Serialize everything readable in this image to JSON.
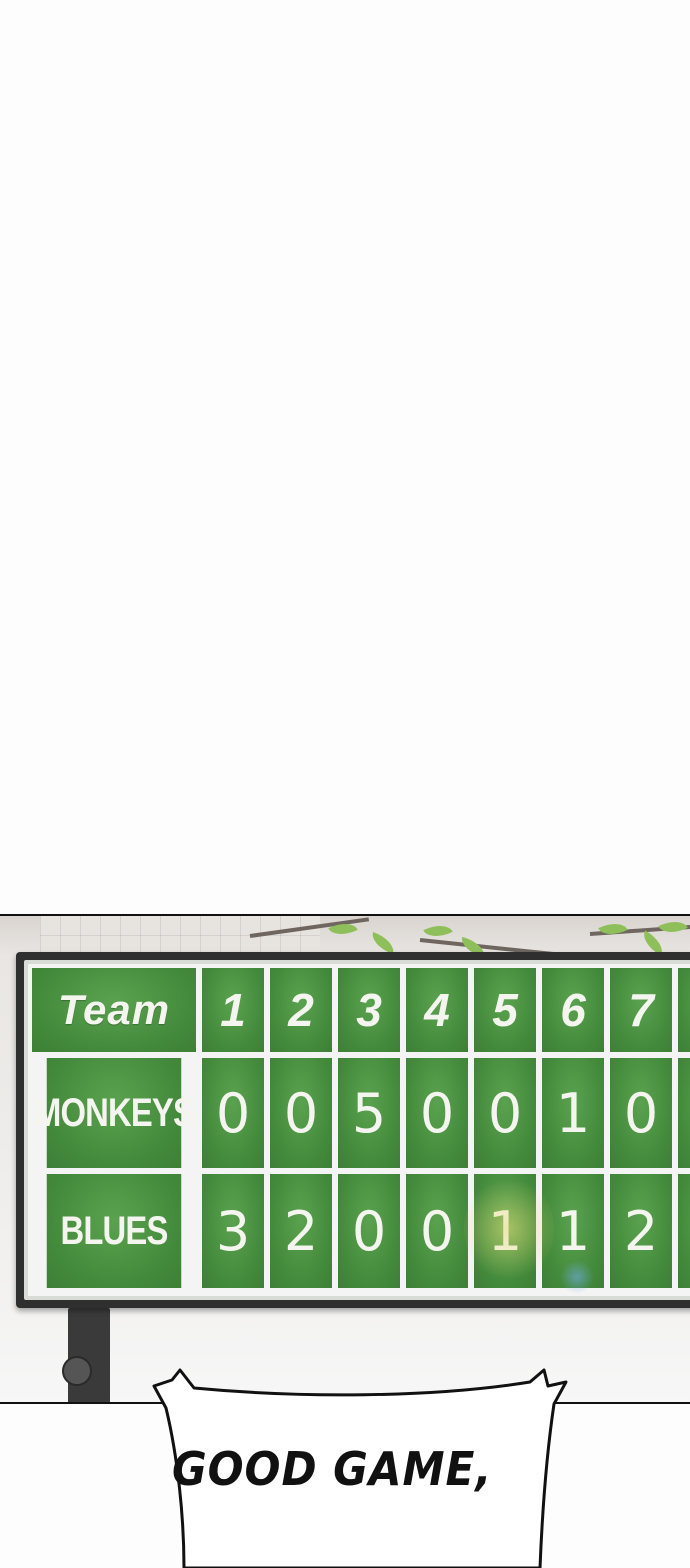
{
  "scoreboard": {
    "header": {
      "team_label": "Team",
      "innings": [
        "1",
        "2",
        "3",
        "4",
        "5",
        "6",
        "7"
      ]
    },
    "rows": [
      {
        "team": "MONKEYS",
        "scores": [
          "0",
          "0",
          "5",
          "0",
          "0",
          "1",
          "0"
        ]
      },
      {
        "team": "BLUES",
        "scores": [
          "3",
          "2",
          "0",
          "0",
          "1",
          "1",
          "2"
        ]
      }
    ],
    "colors": {
      "cell_green": "#43893b",
      "grid_white": "#f4f4f4",
      "frame": "#2f2f2f"
    }
  },
  "speech_bubble": {
    "text": "GOOD GAME,"
  }
}
